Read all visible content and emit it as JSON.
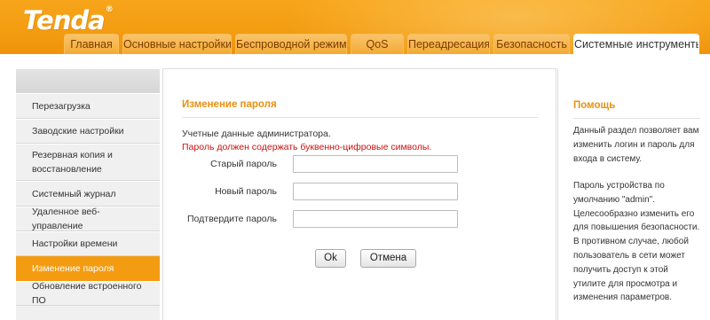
{
  "brand": {
    "logo": "Tenda",
    "reg": "®"
  },
  "tabs": [
    {
      "label": "Главная",
      "active": false
    },
    {
      "label": "Основные настройки",
      "active": false
    },
    {
      "label": "Беспроводной режим",
      "active": false
    },
    {
      "label": "QoS",
      "active": false
    },
    {
      "label": "Переадресация",
      "active": false
    },
    {
      "label": "Безопасность",
      "active": false
    },
    {
      "label": "Системные инструменты",
      "active": true
    }
  ],
  "sidebar": {
    "items": [
      {
        "label": "Перезагрузка"
      },
      {
        "label": "Заводские настройки"
      },
      {
        "label": "Резервная копия и восстановление"
      },
      {
        "label": "Системный журнал"
      },
      {
        "label": "Удаленное веб-управление"
      },
      {
        "label": "Настройки времени"
      },
      {
        "label": "Изменение пароля",
        "active": true
      },
      {
        "label": "Обновление встроенного ПО"
      }
    ]
  },
  "main": {
    "title": "Изменение пароля",
    "credentials_text": "Учетные данные администратора.",
    "warning_text": "Пароль должен содержать буквенно-цифровые символы.",
    "fields": {
      "old_password": {
        "label": "Старый пароль",
        "value": ""
      },
      "new_password": {
        "label": "Новый пароль",
        "value": ""
      },
      "confirm_password": {
        "label": "Подтвердите пароль",
        "value": ""
      }
    },
    "ok_label": "Ok",
    "cancel_label": "Отмена"
  },
  "help": {
    "title": "Помощь",
    "paragraph1": "Данный раздел позволяет вам изменить логин и пароль для входа в систему.",
    "paragraph2": "Пароль устройства по умолчанию \"admin\". Целесообразно изменить его для повышения безопасности. В противном случае, любой пользователь в сети может получить доступ к этой утилите для просмотра и изменения параметров."
  },
  "colors": {
    "accent": "#f39c12",
    "warning": "#cc1111",
    "title": "#e8900f"
  }
}
